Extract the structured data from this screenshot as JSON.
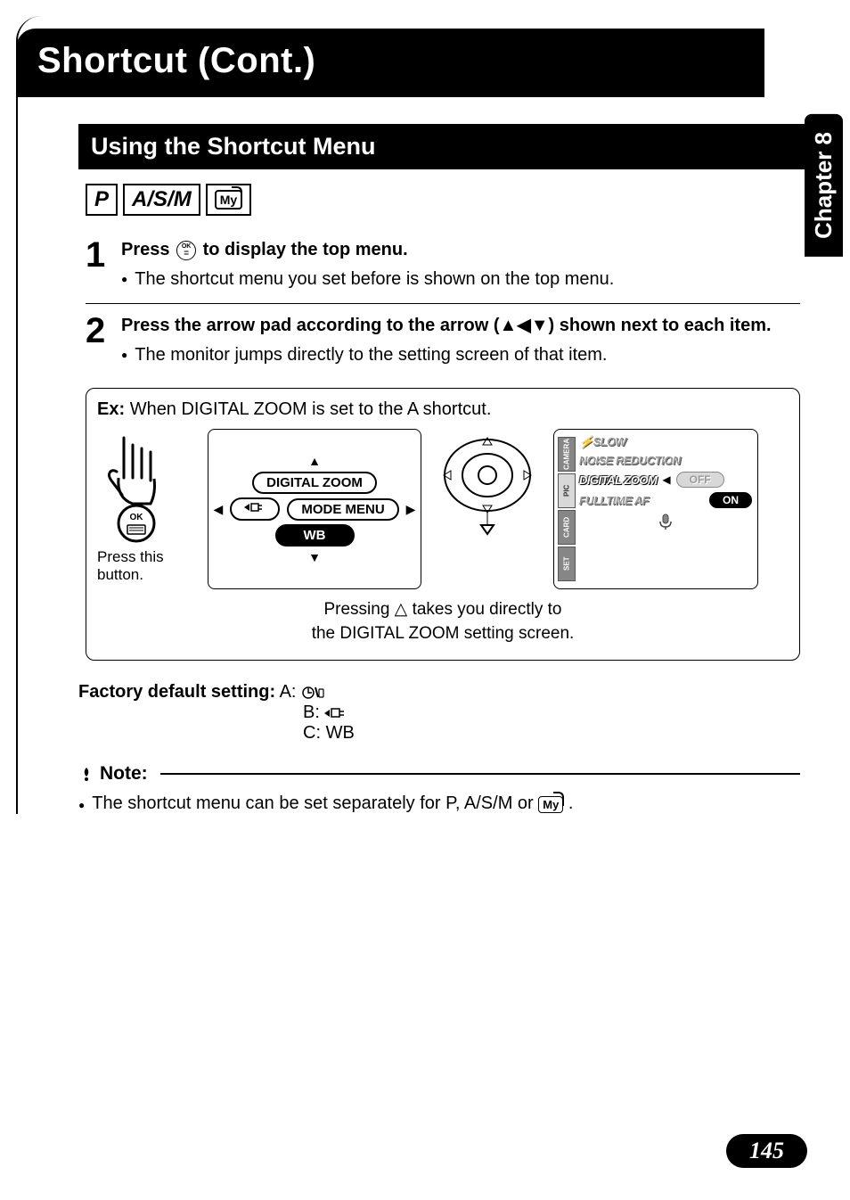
{
  "chapter_tab": "Chapter 8",
  "page_number": "145",
  "title": "Shortcut (Cont.)",
  "section_heading": "Using the Shortcut Menu",
  "modes": {
    "p": "P",
    "asm": "A/S/M",
    "my": "My"
  },
  "steps": [
    {
      "num": "1",
      "head_pre": "Press ",
      "head_post": " to display the top menu.",
      "bullet": "The shortcut menu you set before is shown on the top menu."
    },
    {
      "num": "2",
      "head": "Press the arrow pad according to the arrow (▲◀▼) shown next to each item.",
      "bullet": "The monitor jumps directly to the setting screen of that item."
    }
  ],
  "example": {
    "prefix": "Ex:",
    "text": "When DIGITAL ZOOM is set to the A shortcut.",
    "hand_caption": "Press this button.",
    "arrowpad": {
      "up": "DIGITAL ZOOM",
      "left_icon": "af-target-icon",
      "right": "MODE MENU",
      "down": "WB"
    },
    "lcd": {
      "tabs": [
        "CAMERA",
        "PIC",
        "CARD",
        "SET"
      ],
      "items": [
        "SLOW",
        "NOISE REDUCTION",
        "DIGITAL ZOOM",
        "FULLTIME AF"
      ],
      "active_index": 2,
      "options": {
        "off": "OFF",
        "on": "ON"
      }
    },
    "caption_l1": "Pressing △ takes you directly to",
    "caption_l2": "the DIGITAL ZOOM setting screen."
  },
  "factory": {
    "label": "Factory default setting:",
    "a_label": "A:",
    "a_icon": "drive-remote-icon",
    "b_label": "B:",
    "b_icon": "af-target-icon",
    "c_label": "C:",
    "c_value": "WB"
  },
  "note": {
    "heading": "Note:",
    "body_pre": "The shortcut menu can be set separately for ",
    "p": "P",
    "sep1": ", ",
    "asm": "A/S/M",
    "sep2": " or ",
    "body_post": " ."
  },
  "icons": {
    "ok_button": "OK"
  }
}
